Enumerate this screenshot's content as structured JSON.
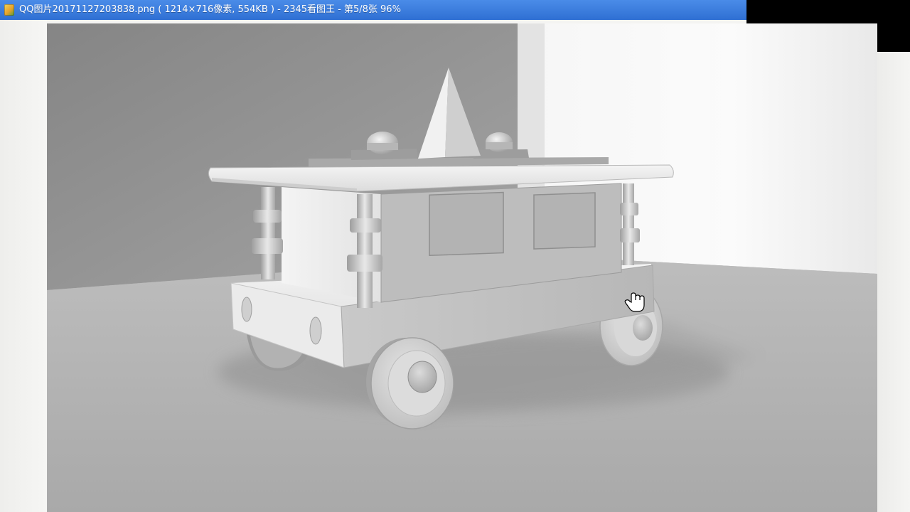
{
  "window": {
    "title": "QQ图片20171127203838.png ( 1214×716像素, 554KB ) - 2345看图王 - 第5/8张 96%",
    "titlebar_color": "#3a7de0"
  },
  "viewer": {
    "image_subject": "grey 3D rendered toy cart"
  },
  "icons": {
    "app_icon": "image-viewer-app-icon",
    "cursor": "hand-pointer-icon"
  }
}
